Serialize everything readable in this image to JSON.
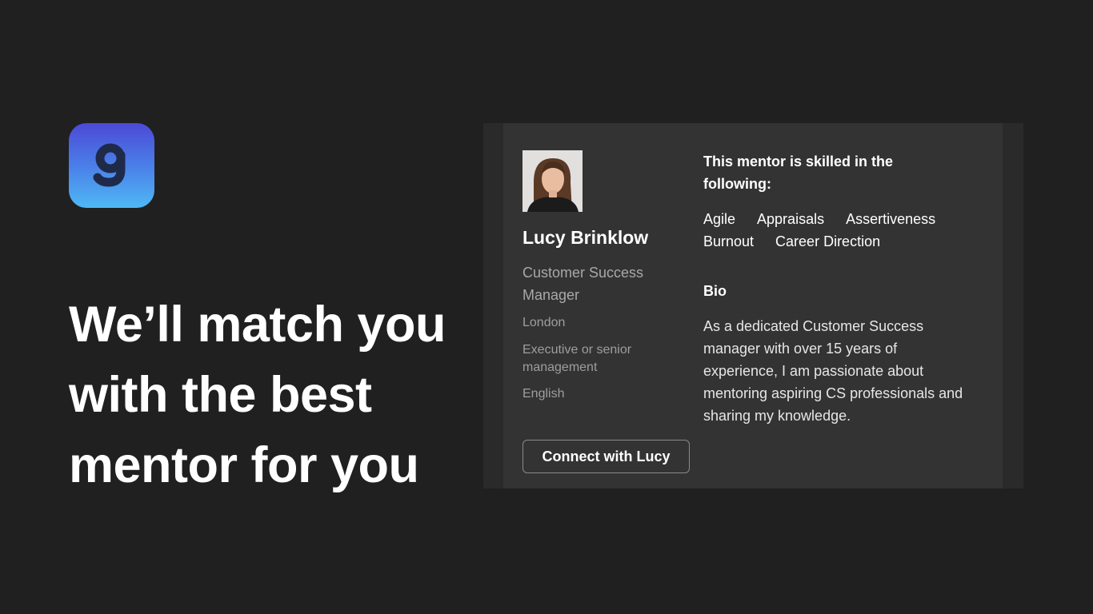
{
  "brand": {
    "logo_icon": "g-logo-icon",
    "gradient_colors": [
      "#4c49d6",
      "#4fb8f5"
    ]
  },
  "headline": "We’ll match you with the best mentor for you",
  "mentor": {
    "photo_icon": "mentor-photo",
    "name": "Lucy Brinklow",
    "title": "Customer Success Manager",
    "location": "London",
    "level": "Executive or senior management",
    "language": "English",
    "connect_label": "Connect with Lucy"
  },
  "skills_section": {
    "heading": "This mentor is skilled in the following:",
    "skills": [
      "Agile",
      "Appraisals",
      "Assertiveness",
      "Burnout",
      "Career Direction"
    ]
  },
  "bio_section": {
    "heading": "Bio",
    "text": "As a dedicated Customer Success manager with over 15 years of experience, I am passionate about mentoring aspiring CS professionals and sharing my knowledge."
  },
  "colors": {
    "background": "#202020",
    "card": "#333333",
    "card_frame": "#2a2a2a",
    "muted_text": "#a8a8a8"
  }
}
